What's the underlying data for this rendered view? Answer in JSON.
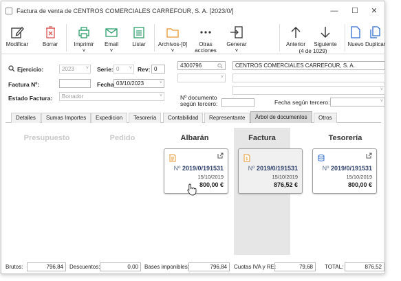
{
  "window": {
    "title": "Factura de venta de CENTROS COMERCIALES CARREFOUR, S. A. [2023/0/]"
  },
  "toolbar": {
    "modificar": "Modificar",
    "borrar": "Borrar",
    "imprimir": "Imprimir",
    "email": "Email",
    "listar": "Listar",
    "archivos": "Archivos-[0]",
    "otras_acciones_1": "Otras",
    "otras_acciones_2": "acciones",
    "generar": "Generar",
    "anterior": "Anterior",
    "siguiente": "Siguiente",
    "position": "(4 de 1029)",
    "nuevo": "Nuevo",
    "duplicar": "Duplicar"
  },
  "form": {
    "ejercicio_label": "Ejercicio:",
    "ejercicio_value": "2023",
    "serie_label": "Serie:",
    "serie_value": "0",
    "rev_label": "Rev:",
    "rev_value": "0",
    "factura_label": "Factura Nº:",
    "factura_value": "",
    "fecha_label": "Fecha:",
    "fecha_value": "03/10/2023",
    "estado_label": "Estado Factura:",
    "estado_value": "Borrador",
    "client_code": "4300796",
    "client_name": "CENTROS COMERCIALES CARREFOUR, S. A.",
    "nro_doc_label_1": "Nº documento",
    "nro_doc_label_2": "según tercero:",
    "fecha_tercero_label": "Fecha según tercero:"
  },
  "tabs": [
    {
      "label": "Detalles"
    },
    {
      "label": "Sumas Importes"
    },
    {
      "label": "Expedicion"
    },
    {
      "label": "Tesorería"
    },
    {
      "label": "Contabilidad"
    },
    {
      "label": "Representante"
    },
    {
      "label": "Árbol de documentos"
    },
    {
      "label": "Otros"
    }
  ],
  "tree": {
    "columns": {
      "presupuesto": "Presupuesto",
      "pedido": "Pedido",
      "albaran": "Albarán",
      "factura": "Factura",
      "tesoreria": "Tesorería"
    },
    "cards": {
      "albaran": {
        "prefix": "Nº",
        "number": "2019/0/191531",
        "date": "15/10/2019",
        "amount": "800,00 €"
      },
      "factura": {
        "prefix": "Nº",
        "number": "2019/0/191531",
        "date": "15/10/2019",
        "amount": "876,52 €"
      },
      "tesoreria": {
        "prefix": "Nº",
        "number": "2019/0/191531",
        "date": "15/10/2019",
        "amount": "800,00 €"
      }
    }
  },
  "footer": {
    "brutos_label": "Brutos:",
    "brutos_value": "796,84",
    "descuentos_label": "Descuentos:",
    "descuentos_value": "0,00",
    "bases_label": "Bases imponibles:",
    "bases_value": "796,84",
    "cuotas_label": "Cuotas IVA y RE:",
    "cuotas_value": "79,68",
    "total_label": "TOTAL:",
    "total_value": "876,52"
  },
  "colors": {
    "accent_blue": "#2f6fd0",
    "accent_orange": "#e8962e",
    "accent_red": "#d9534f",
    "accent_green": "#2e9e6a"
  }
}
